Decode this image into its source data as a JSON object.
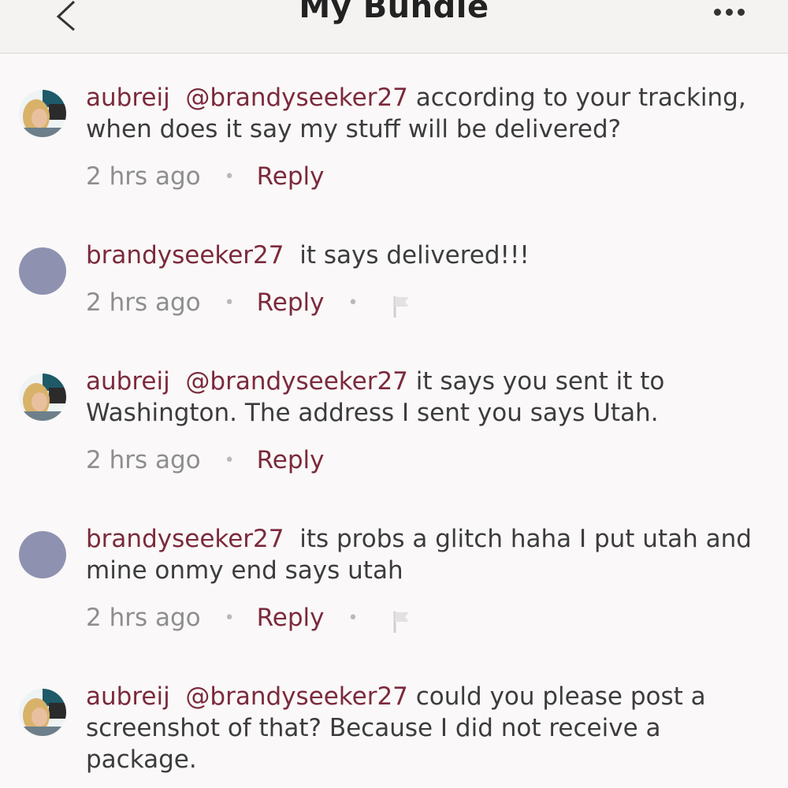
{
  "header": {
    "title": "My Bundle",
    "back_icon": "chevron-left-icon",
    "more_icon": "more-dots-icon"
  },
  "comments": [
    {
      "user": "aubreij",
      "mention": "@brandyseeker27",
      "body": "according to your tracking, when does it say my stuff will be delivered?",
      "time": "2 hrs ago",
      "reply_label": "Reply",
      "avatar": "user-photo"
    },
    {
      "user": "brandyseeker27",
      "mention": "",
      "body": "it says delivered!!!",
      "time": "2 hrs ago",
      "reply_label": "Reply",
      "avatar": "default-avatar",
      "flag_icon": "flag-icon"
    },
    {
      "user": "aubreij",
      "mention": "@brandyseeker27",
      "body": "it says you sent it to Washington. The address I sent you says Utah.",
      "time": "2 hrs ago",
      "reply_label": "Reply",
      "avatar": "user-photo"
    },
    {
      "user": "brandyseeker27",
      "mention": "",
      "body": "its probs a glitch haha I put utah and mine onmy end says utah",
      "time": "2 hrs ago",
      "reply_label": "Reply",
      "avatar": "default-avatar",
      "flag_icon": "flag-icon"
    },
    {
      "user": "aubreij",
      "mention": "@brandyseeker27",
      "body": "could you please post a screenshot of that? Because I did not receive a package.",
      "time": "",
      "reply_label": "",
      "avatar": "user-photo"
    }
  ],
  "separator": "•",
  "colors": {
    "accent": "#7b2a3c",
    "muted": "#8e8e8e",
    "default_avatar": "#8e92b0",
    "header_bg": "#f5f3f1",
    "page_bg": "#faf8f8"
  }
}
